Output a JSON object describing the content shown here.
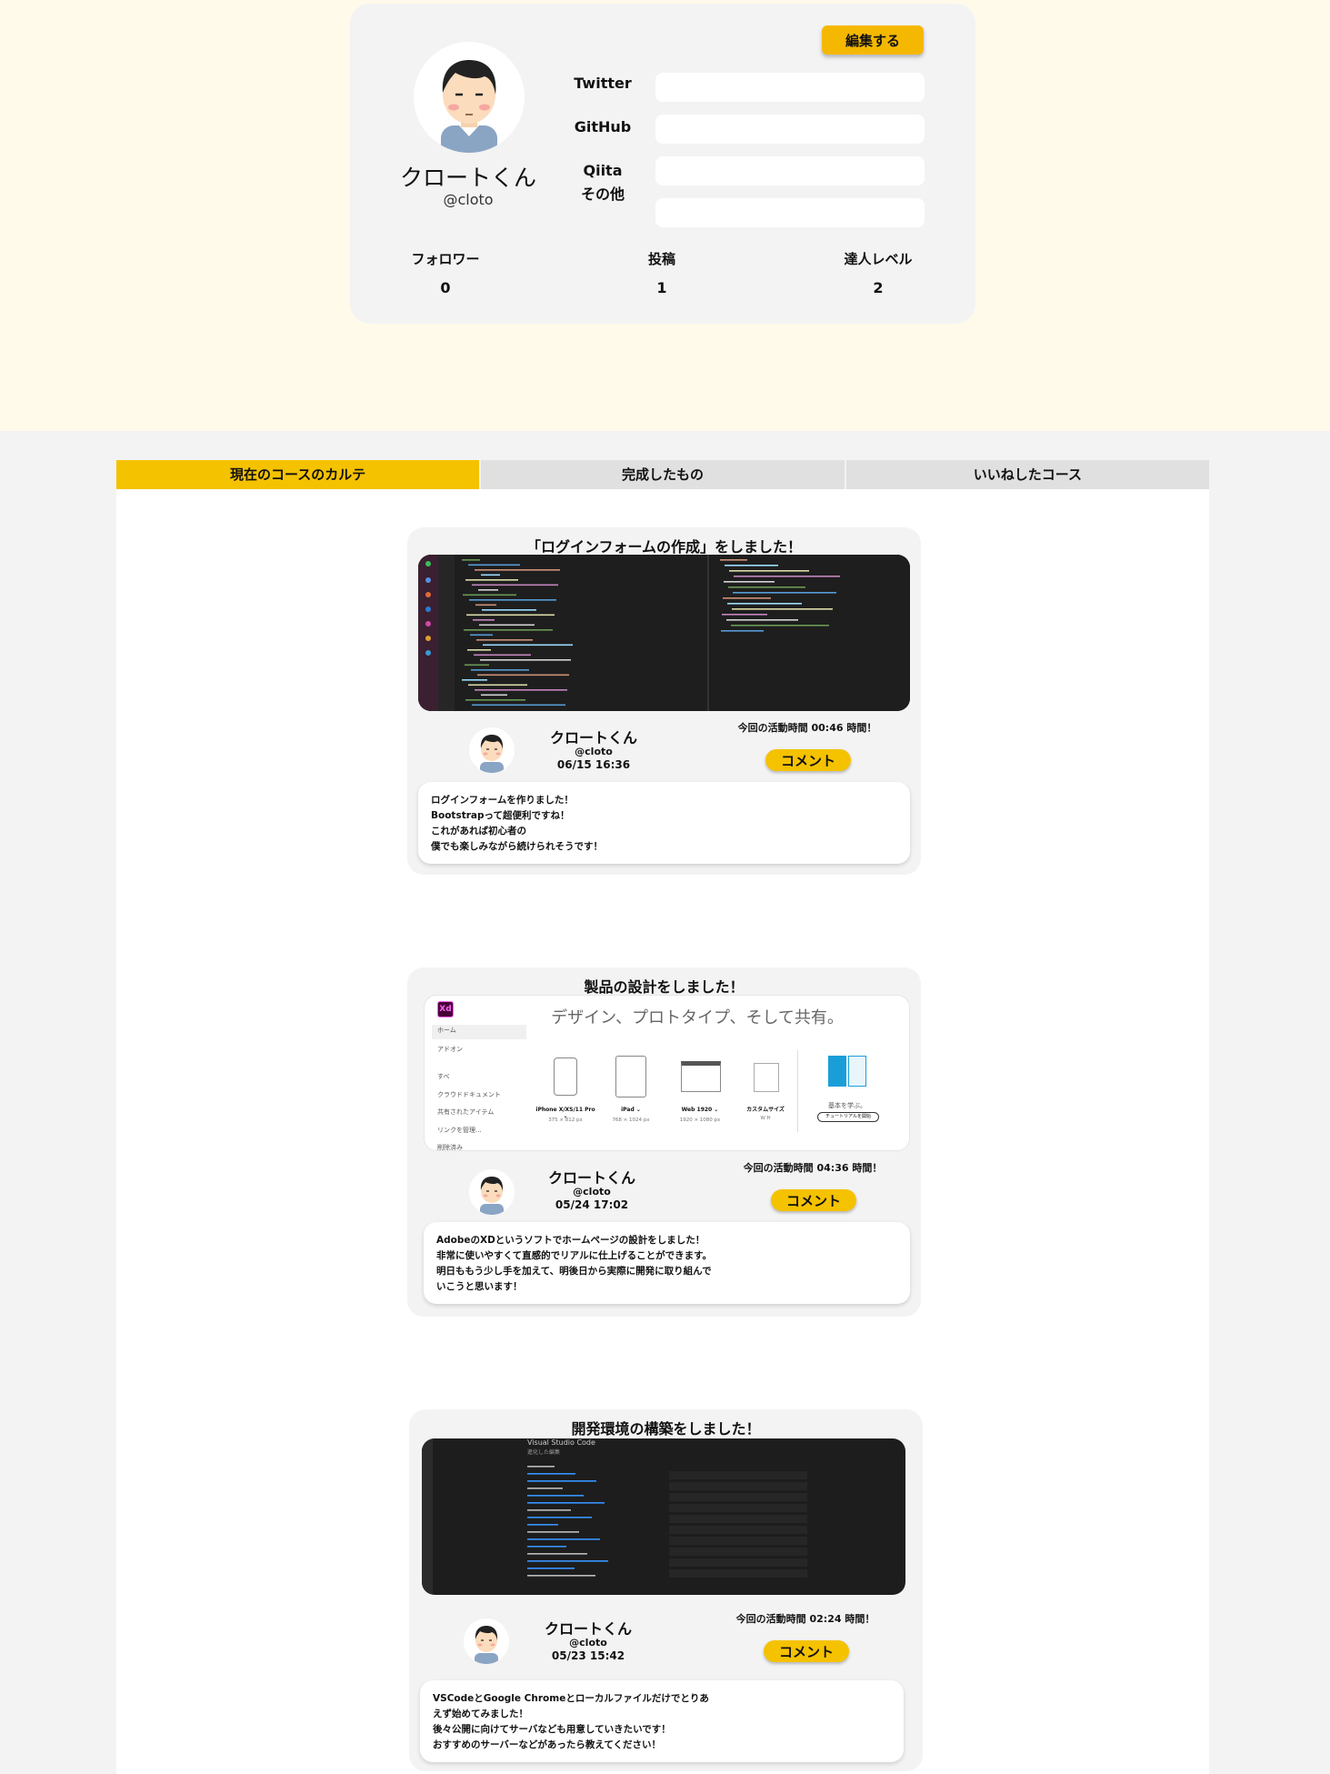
{
  "profile": {
    "edit_label": "編集する",
    "name": "クロートくん",
    "handle": "@cloto",
    "links": [
      {
        "label": "Twitter",
        "value": ""
      },
      {
        "label": "GitHub",
        "value": ""
      },
      {
        "label": "Qiita",
        "value": ""
      },
      {
        "label": "その他",
        "value": ""
      }
    ],
    "stats": [
      {
        "label": "フォロワー",
        "value": "0"
      },
      {
        "label": "投稿",
        "value": "1"
      },
      {
        "label": "達人レベル",
        "value": "2"
      }
    ]
  },
  "tabs": [
    {
      "label": "現在のコースのカルテ",
      "active": true
    },
    {
      "label": "完成したもの",
      "active": false
    },
    {
      "label": "いいねしたコース",
      "active": false
    }
  ],
  "posts": [
    {
      "title": "「ログインフォームの作成」をしました！",
      "author": "クロートくん",
      "handle": "@cloto",
      "date": "06/15 16:36",
      "activity": "今回の活動時間 00:46 時間！",
      "comment_label": "コメント",
      "body": [
        "ログインフォームを作りました！",
        "Bootstrapって超便利ですね！",
        "これがあれば初心者の",
        "僕でも楽しみながら続けられそうです！"
      ]
    },
    {
      "title": "製品の設計をしました！",
      "author": "クロートくん",
      "handle": "@cloto",
      "date": "05/24 17:02",
      "activity": "今回の活動時間 04:36 時間！",
      "comment_label": "コメント",
      "body": [
        "AdobeのXDというソフトでホームページの設計をしました！",
        "非常に使いやすくて直感的でリアルに仕上げることができます。",
        "明日ももう少し手を加えて、明後日から実際に開発に取り組んで",
        "いこうと思います！"
      ],
      "shot": {
        "app_icon": "Xd",
        "headline": "デザイン、プロトタイプ、そして共有。",
        "menu": [
          "ホーム",
          "アドオン",
          "すべ",
          "クラウドドキュメント",
          "共有されたアイテム",
          "リンクを管理...",
          "削除済み"
        ],
        "presets": [
          {
            "name": "iPhone X/XS/11 Pro ⌄",
            "size": "375 × 812 px"
          },
          {
            "name": "iPad ⌄",
            "size": "768 × 1024 px"
          },
          {
            "name": "Web 1920 ⌄",
            "size": "1920 × 1080 px"
          },
          {
            "name": "カスタムサイズ",
            "size": "W        H"
          }
        ],
        "learn_title": "基本を学ぶ。",
        "learn_button": "チュートリアルを開始"
      }
    },
    {
      "title": "開発環境の構築をしました！",
      "author": "クロートくん",
      "handle": "@cloto",
      "date": "05/23 15:42",
      "activity": "今回の活動時間 02:24 時間！",
      "comment_label": "コメント",
      "body": [
        "VSCodeとGoogle Chromeとローカルファイルだけでとりあ",
        "えず始めてみました！",
        "後々公開に向けてサーバなども用意していきたいです！",
        "おすすめのサーバーなどがあったら教えてください！"
      ],
      "shot": {
        "title": "Visual Studio Code",
        "subtitle": "進化した編集"
      }
    }
  ]
}
